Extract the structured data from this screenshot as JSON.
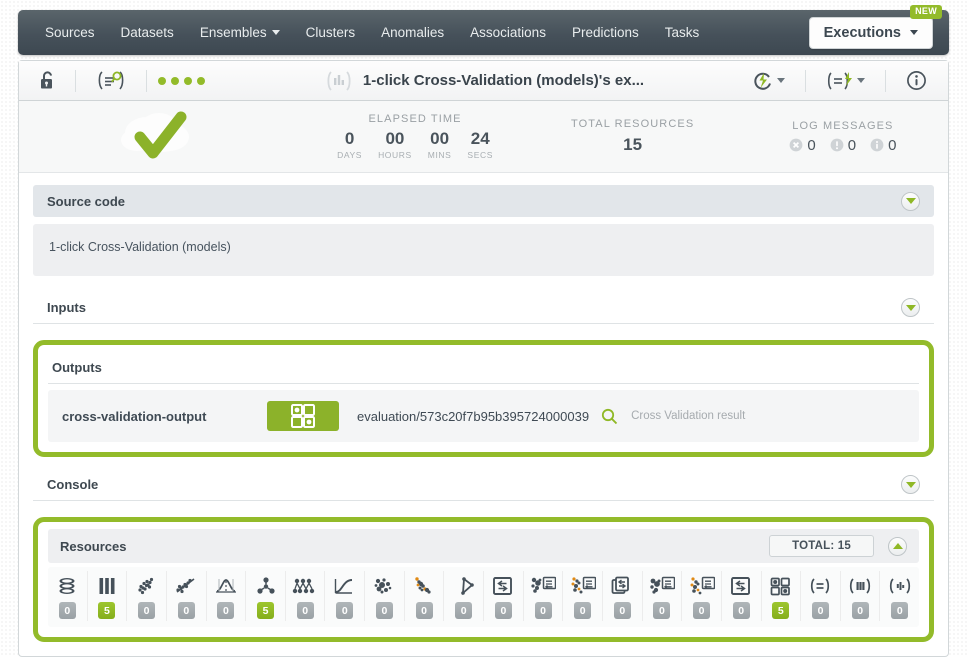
{
  "nav": {
    "items": [
      {
        "label": "Sources",
        "dropdown": false
      },
      {
        "label": "Datasets",
        "dropdown": false
      },
      {
        "label": "Ensembles",
        "dropdown": true
      },
      {
        "label": "Clusters",
        "dropdown": false
      },
      {
        "label": "Anomalies",
        "dropdown": false
      },
      {
        "label": "Associations",
        "dropdown": false
      },
      {
        "label": "Predictions",
        "dropdown": false
      },
      {
        "label": "Tasks",
        "dropdown": false
      }
    ],
    "executions_label": "Executions",
    "new_badge": "NEW"
  },
  "toolbar": {
    "title": "1-click Cross-Validation (models)'s ex...",
    "lock_icon": "unlocked-padlock-icon",
    "script_icon": "script-search-icon",
    "status_dots": 4
  },
  "stats": {
    "status_icon": "cloud-check-icon",
    "elapsed_label": "ELAPSED TIME",
    "elapsed": [
      {
        "value": "0",
        "unit": "DAYS"
      },
      {
        "value": "00",
        "unit": "HOURS"
      },
      {
        "value": "00",
        "unit": "MINS"
      },
      {
        "value": "24",
        "unit": "SECS"
      }
    ],
    "total_resources_label": "TOTAL RESOURCES",
    "total_resources_value": "15",
    "log_messages_label": "LOG MESSAGES",
    "logs": [
      {
        "kind": "error",
        "count": "0"
      },
      {
        "kind": "warning",
        "count": "0"
      },
      {
        "kind": "info",
        "count": "0"
      }
    ]
  },
  "sections": {
    "source_code": {
      "title": "Source code",
      "content": "1-click Cross-Validation (models)"
    },
    "inputs": {
      "title": "Inputs"
    },
    "outputs": {
      "title": "Outputs",
      "row": {
        "name": "cross-validation-output",
        "resource_id": "evaluation/573c20f7b95b395724000039",
        "description": "Cross Validation result",
        "icon": "evaluation-icon"
      }
    },
    "console": {
      "title": "Console"
    },
    "resources": {
      "title": "Resources",
      "total_label": "TOTAL: 15",
      "items": [
        {
          "icon": "source-icon",
          "count": "0",
          "active": false
        },
        {
          "icon": "dataset-icon",
          "count": "5",
          "active": true
        },
        {
          "icon": "model-icon",
          "count": "0",
          "active": false
        },
        {
          "icon": "linear-regression-icon",
          "count": "0",
          "active": false
        },
        {
          "icon": "anomaly-icon",
          "count": "0",
          "active": false
        },
        {
          "icon": "ensemble-icon",
          "count": "5",
          "active": true
        },
        {
          "icon": "cluster-icon",
          "count": "0",
          "active": false
        },
        {
          "icon": "logistic-regression-icon",
          "count": "0",
          "active": false
        },
        {
          "icon": "association-icon",
          "count": "0",
          "active": false
        },
        {
          "icon": "anomaly-score-icon",
          "count": "0",
          "active": false
        },
        {
          "icon": "topic-model-icon",
          "count": "0",
          "active": false
        },
        {
          "icon": "prediction-icon",
          "count": "0",
          "active": false
        },
        {
          "icon": "centroid-icon",
          "count": "0",
          "active": false
        },
        {
          "icon": "batch-anomaly-score-icon",
          "count": "0",
          "active": false
        },
        {
          "icon": "batch-prediction-icon",
          "count": "0",
          "active": false
        },
        {
          "icon": "batch-centroid-icon",
          "count": "0",
          "active": false
        },
        {
          "icon": "batch-topic-distribution-icon",
          "count": "0",
          "active": false
        },
        {
          "icon": "configuration-icon",
          "count": "0",
          "active": false
        },
        {
          "icon": "evaluation-icon",
          "count": "5",
          "active": true
        },
        {
          "icon": "script-icon",
          "count": "0",
          "active": false
        },
        {
          "icon": "library-icon",
          "count": "0",
          "active": false
        },
        {
          "icon": "execution-icon",
          "count": "0",
          "active": false
        }
      ]
    }
  },
  "colors": {
    "brand_green": "#93bb2a",
    "nav_dark": "#46515a",
    "text_dark": "#3e4850",
    "muted": "#a6abaf"
  }
}
